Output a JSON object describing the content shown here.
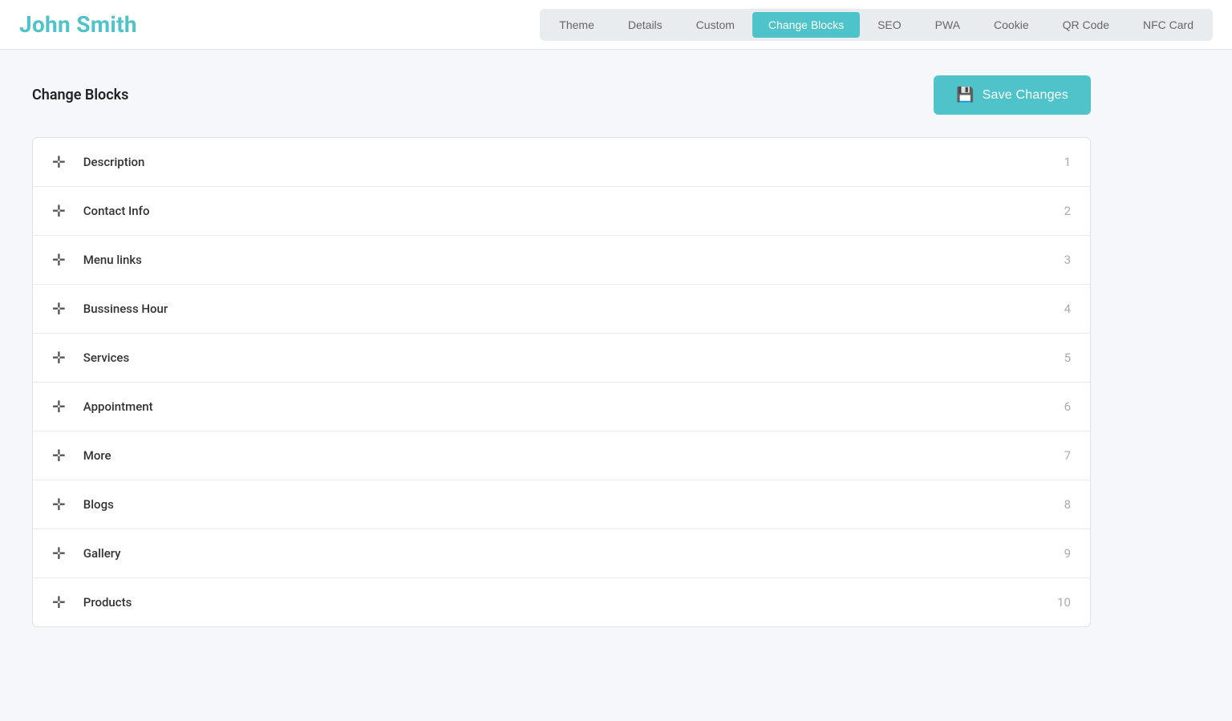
{
  "header": {
    "title": "John Smith",
    "nav": {
      "tabs": [
        {
          "id": "theme",
          "label": "Theme",
          "active": false
        },
        {
          "id": "details",
          "label": "Details",
          "active": false
        },
        {
          "id": "custom",
          "label": "Custom",
          "active": false
        },
        {
          "id": "change-blocks",
          "label": "Change Blocks",
          "active": true
        },
        {
          "id": "seo",
          "label": "SEO",
          "active": false
        },
        {
          "id": "pwa",
          "label": "PWA",
          "active": false
        },
        {
          "id": "cookie",
          "label": "Cookie",
          "active": false
        },
        {
          "id": "qr-code",
          "label": "QR Code",
          "active": false
        },
        {
          "id": "nfc-card",
          "label": "NFC Card",
          "active": false
        }
      ]
    }
  },
  "main": {
    "page_title": "Change Blocks",
    "save_button_label": "Save Changes",
    "blocks": [
      {
        "id": 1,
        "label": "Description",
        "number": 1
      },
      {
        "id": 2,
        "label": "Contact Info",
        "number": 2
      },
      {
        "id": 3,
        "label": "Menu links",
        "number": 3
      },
      {
        "id": 4,
        "label": "Bussiness Hour",
        "number": 4
      },
      {
        "id": 5,
        "label": "Services",
        "number": 5
      },
      {
        "id": 6,
        "label": "Appointment",
        "number": 6
      },
      {
        "id": 7,
        "label": "More",
        "number": 7
      },
      {
        "id": 8,
        "label": "Blogs",
        "number": 8
      },
      {
        "id": 9,
        "label": "Gallery",
        "number": 9
      },
      {
        "id": 10,
        "label": "Products",
        "number": 10
      }
    ]
  },
  "colors": {
    "accent": "#4ec3c9",
    "text_muted": "#aaa"
  }
}
